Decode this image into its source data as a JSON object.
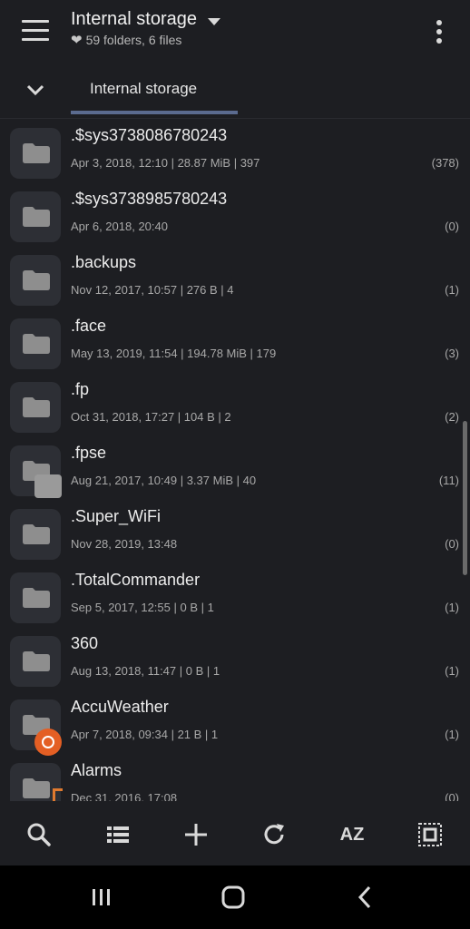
{
  "header": {
    "title": "Internal storage",
    "subtitle": "59 folders, 6 files"
  },
  "tabs": [
    {
      "label": "Internal storage",
      "active": true
    }
  ],
  "files": [
    {
      "name": ".$sys3738086780243",
      "meta": "Apr 3, 2018, 12:10 | 28.87 MiB | 397",
      "count": "(378)",
      "badge": ""
    },
    {
      "name": ".$sys3738985780243",
      "meta": "Apr 6, 2018, 20:40",
      "count": "(0)",
      "badge": ""
    },
    {
      "name": ".backups",
      "meta": "Nov 12, 2017, 10:57 | 276 B | 4",
      "count": "(1)",
      "badge": ""
    },
    {
      "name": ".face",
      "meta": "May 13, 2019, 11:54 | 194.78 MiB | 179",
      "count": "(3)",
      "badge": ""
    },
    {
      "name": ".fp",
      "meta": "Oct 31, 2018, 17:27 | 104 B | 2",
      "count": "(2)",
      "badge": ""
    },
    {
      "name": ".fpse",
      "meta": "Aug 21, 2017, 10:49 | 3.37 MiB | 40",
      "count": "(11)",
      "badge": "fpse"
    },
    {
      "name": ".Super_WiFi",
      "meta": "Nov 28, 2019, 13:48",
      "count": "(0)",
      "badge": ""
    },
    {
      "name": ".TotalCommander",
      "meta": "Sep 5, 2017, 12:55 | 0 B | 1",
      "count": "(1)",
      "badge": ""
    },
    {
      "name": "360",
      "meta": "Aug 13, 2018, 11:47 | 0 B | 1",
      "count": "(1)",
      "badge": ""
    },
    {
      "name": "AccuWeather",
      "meta": "Apr 7, 2018, 09:34 | 21 B | 1",
      "count": "(1)",
      "badge": "accuweather"
    },
    {
      "name": "Alarms",
      "meta": "Dec 31, 2016, 17:08",
      "count": "(0)",
      "badge": "alarm"
    }
  ],
  "toolbar": {
    "sort_label": "AZ"
  },
  "colors": {
    "background": "#1d1e22",
    "accent": "#5b6b8f",
    "folder_tile": "#2d2f35",
    "folder_icon": "#8e8e8e"
  }
}
